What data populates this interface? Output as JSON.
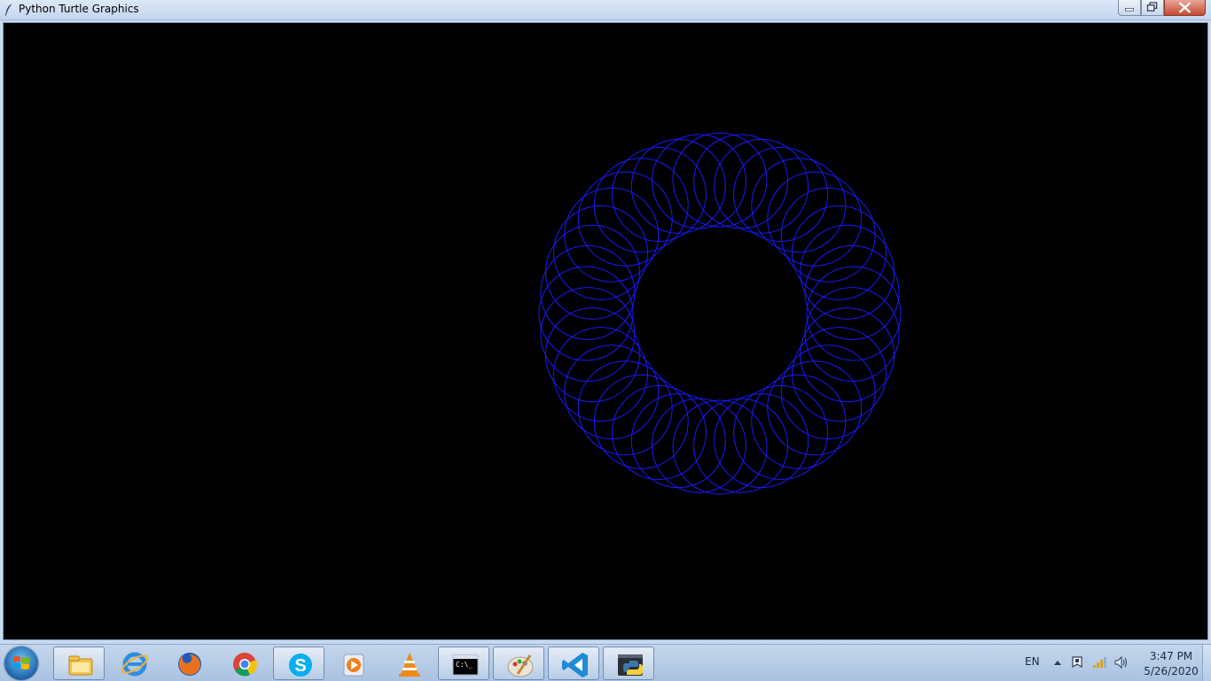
{
  "window": {
    "title": "Python Turtle Graphics",
    "canvas_bg": "#000000",
    "pen_color": "#1a1aff",
    "title_icon": "feather-icon"
  },
  "controls": {
    "minimize_icon": "minimize-icon",
    "maximize_icon": "restore-icon",
    "close_icon": "close-icon"
  },
  "taskbar": {
    "start_icon": "windows-orb-icon",
    "pinned": [
      {
        "name": "file-explorer-icon",
        "active": true
      },
      {
        "name": "internet-explorer-icon",
        "active": false
      },
      {
        "name": "firefox-icon",
        "active": false
      },
      {
        "name": "chrome-icon",
        "active": false
      },
      {
        "name": "skype-icon",
        "active": true
      },
      {
        "name": "media-player-icon",
        "active": false
      },
      {
        "name": "vlc-icon",
        "active": false
      },
      {
        "name": "command-prompt-icon",
        "active": true
      },
      {
        "name": "paint-icon",
        "active": true
      },
      {
        "name": "vscode-icon",
        "active": true
      },
      {
        "name": "python-icon",
        "active": true
      }
    ],
    "language": "EN",
    "clock_time": "3:47 PM",
    "clock_date": "5/26/2020"
  }
}
